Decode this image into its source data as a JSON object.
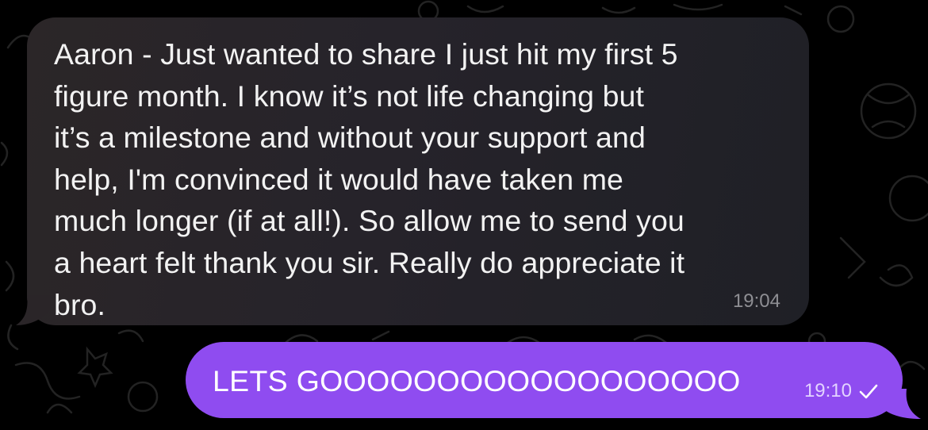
{
  "colors": {
    "background": "#000000",
    "incoming_bubble": "#26232a",
    "outgoing_bubble": "#8f4cf0",
    "incoming_text": "#f2f2f2",
    "outgoing_text": "#ffffff",
    "timestamp_in": "#8e8e93",
    "timestamp_out": "#e3d3ff"
  },
  "messages": [
    {
      "direction": "incoming",
      "text": "Aaron - Just wanted to share I just hit my first 5\nfigure month. I know it’s not life changing but\nit’s a milestone and without your support and\nhelp, I'm convinced it would have taken me\nmuch longer (if at all!). So allow me to send you\na heart felt thank you sir. Really do appreciate it\nbro.",
      "time": "19:04"
    },
    {
      "direction": "outgoing",
      "text": "LETS GOOOOOOOOOOOOOOOOOO",
      "time": "19:10",
      "status_icon": "check-icon"
    }
  ]
}
